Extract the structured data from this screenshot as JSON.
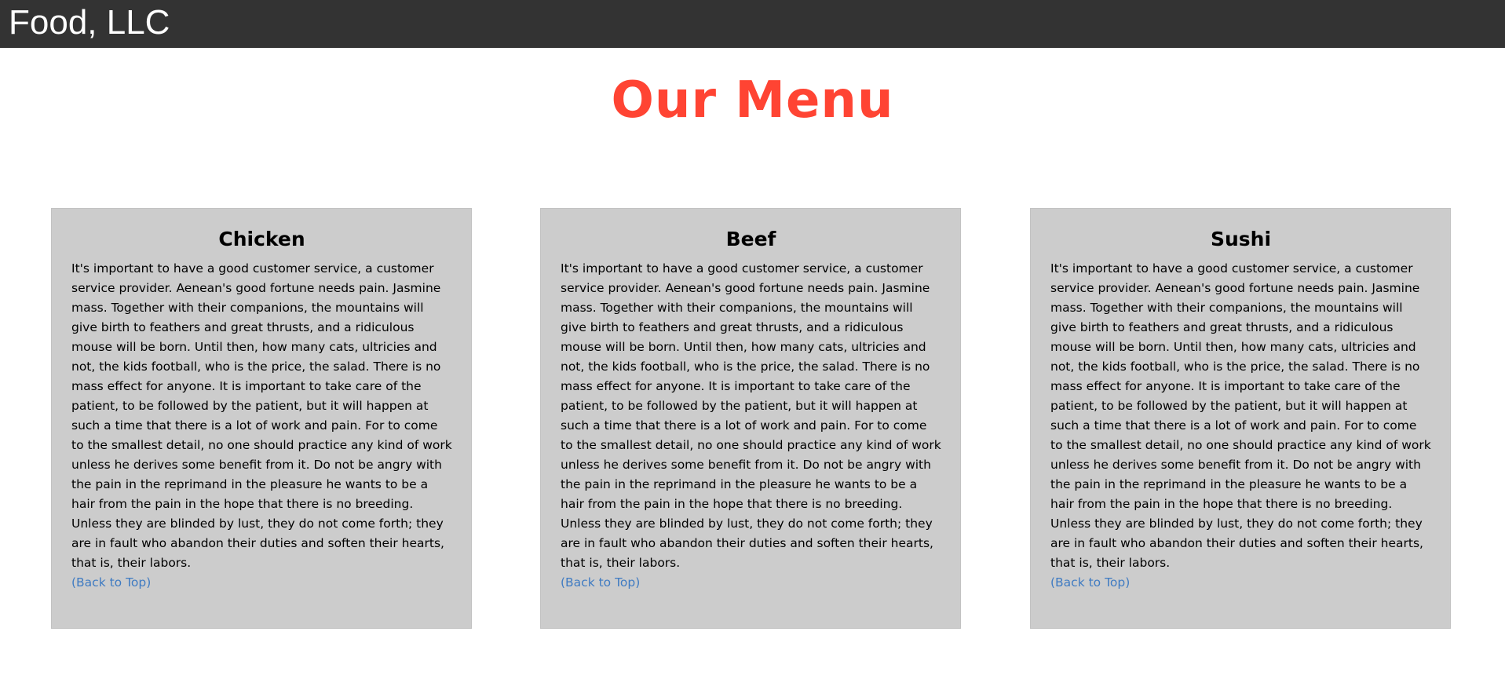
{
  "header": {
    "brand": "Food, LLC"
  },
  "page": {
    "title": "Our Menu"
  },
  "menu": {
    "items": [
      {
        "name": "Chicken",
        "description": "It's important to have a good customer service, a customer service provider. Aenean's good fortune needs pain. Jasmine mass. Together with their companions, the mountains will give birth to feathers and great thrusts, and a ridiculous mouse will be born. Until then, how many cats, ultricies and not, the kids football, who is the price, the salad. There is no mass effect for anyone. It is important to take care of the patient, to be followed by the patient, but it will happen at such a time that there is a lot of work and pain. For to come to the smallest detail, no one should practice any kind of work unless he derives some benefit from it. Do not be angry with the pain in the reprimand in the pleasure he wants to be a hair from the pain in the hope that there is no breeding. Unless they are blinded by lust, they do not come forth; they are in fault who abandon their duties and soften their hearts, that is, their labors.",
        "link": "(Back to Top)"
      },
      {
        "name": "Beef",
        "description": "It's important to have a good customer service, a customer service provider. Aenean's good fortune needs pain. Jasmine mass. Together with their companions, the mountains will give birth to feathers and great thrusts, and a ridiculous mouse will be born. Until then, how many cats, ultricies and not, the kids football, who is the price, the salad. There is no mass effect for anyone. It is important to take care of the patient, to be followed by the patient, but it will happen at such a time that there is a lot of work and pain. For to come to the smallest detail, no one should practice any kind of work unless he derives some benefit from it. Do not be angry with the pain in the reprimand in the pleasure he wants to be a hair from the pain in the hope that there is no breeding. Unless they are blinded by lust, they do not come forth; they are in fault who abandon their duties and soften their hearts, that is, their labors.",
        "link": "(Back to Top)"
      },
      {
        "name": "Sushi",
        "description": "It's important to have a good customer service, a customer service provider. Aenean's good fortune needs pain. Jasmine mass. Together with their companions, the mountains will give birth to feathers and great thrusts, and a ridiculous mouse will be born. Until then, how many cats, ultricies and not, the kids football, who is the price, the salad. There is no mass effect for anyone. It is important to take care of the patient, to be followed by the patient, but it will happen at such a time that there is a lot of work and pain. For to come to the smallest detail, no one should practice any kind of work unless he derives some benefit from it. Do not be angry with the pain in the reprimand in the pleasure he wants to be a hair from the pain in the hope that there is no breeding. Unless they are blinded by lust, they do not come forth; they are in fault who abandon their duties and soften their hearts, that is, their labors.",
        "link": "(Back to Top)"
      }
    ]
  },
  "colors": {
    "header_background": "#333333",
    "title": "#ff4433",
    "card_background": "#cccccc",
    "link": "#3f7bc2"
  }
}
